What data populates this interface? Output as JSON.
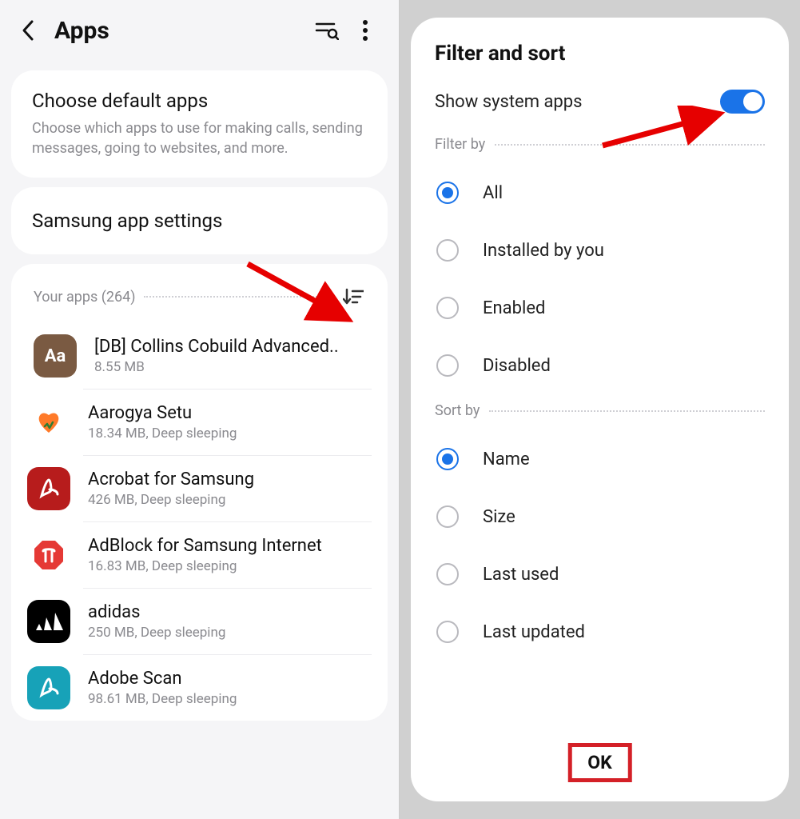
{
  "left": {
    "title": "Apps",
    "default_card": {
      "title": "Choose default apps",
      "subtitle": "Choose which apps to use for making calls, sending messages, going to websites, and more."
    },
    "samsung_card_title": "Samsung app settings",
    "your_apps_label": "Your apps (264)",
    "apps": [
      {
        "name": "[DB] Collins Cobuild Advanced..",
        "meta": "8.55 MB"
      },
      {
        "name": "Aarogya Setu",
        "meta": "18.34 MB, Deep sleeping"
      },
      {
        "name": "Acrobat for Samsung",
        "meta": "426 MB, Deep sleeping"
      },
      {
        "name": "AdBlock for Samsung Internet",
        "meta": "16.83 MB, Deep sleeping"
      },
      {
        "name": "adidas",
        "meta": "250 MB, Deep sleeping"
      },
      {
        "name": "Adobe Scan",
        "meta": "98.61 MB, Deep sleeping"
      }
    ]
  },
  "right": {
    "title": "Filter and sort",
    "toggle_label": "Show system apps",
    "toggle_on": true,
    "filter_label": "Filter by",
    "filter_options": [
      {
        "label": "All",
        "checked": true
      },
      {
        "label": "Installed by you",
        "checked": false
      },
      {
        "label": "Enabled",
        "checked": false
      },
      {
        "label": "Disabled",
        "checked": false
      }
    ],
    "sort_label": "Sort by",
    "sort_options": [
      {
        "label": "Name",
        "checked": true
      },
      {
        "label": "Size",
        "checked": false
      },
      {
        "label": "Last used",
        "checked": false
      },
      {
        "label": "Last updated",
        "checked": false
      }
    ],
    "ok_label": "OK"
  }
}
